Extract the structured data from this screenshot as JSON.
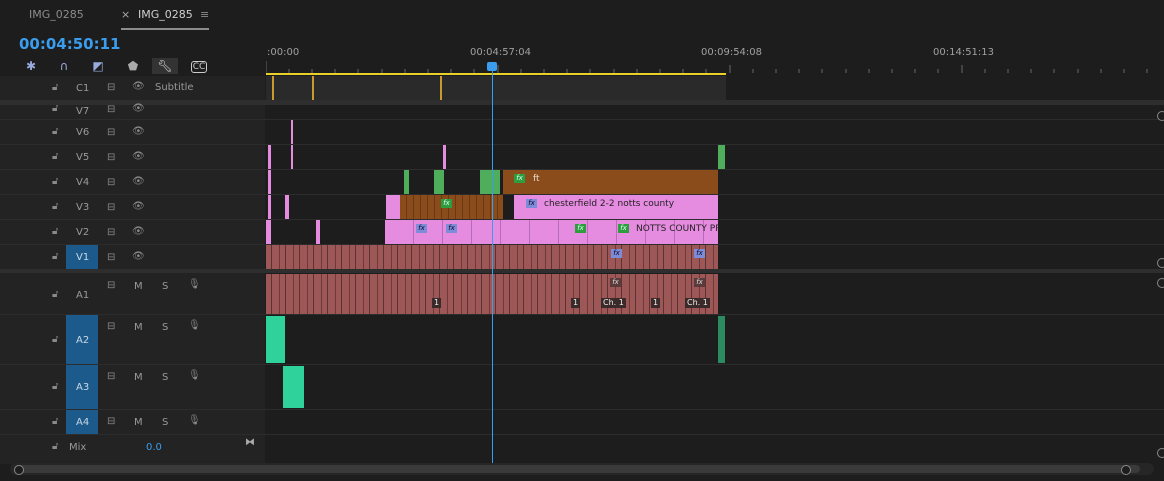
{
  "tabs": [
    {
      "label": "IMG_0285"
    },
    {
      "label": "IMG_0285",
      "close": "×",
      "menu": "≡"
    }
  ],
  "timecode": "00:04:50:11",
  "ruler": {
    "labels": [
      ":00:00",
      "00:04:57:04",
      "00:09:54:08",
      "00:14:51:13"
    ]
  },
  "tracks": {
    "caption": {
      "name": "C1",
      "label": "Subtitle"
    },
    "video": [
      "V7",
      "V6",
      "V5",
      "V4",
      "V3",
      "V2",
      "V1"
    ],
    "audio": [
      "A1",
      "A2",
      "A3",
      "A4"
    ],
    "mute": "M",
    "solo": "S",
    "mix": {
      "label": "Mix",
      "value": "0.0"
    }
  },
  "clips": {
    "v4_label": "ft",
    "v3_label": "chesterfield 2-2 notts county",
    "v2_label": "NOTTS COUNTY PR",
    "fx": "fx",
    "marker_one": "1",
    "chapter": "Ch. 1"
  },
  "colors": {
    "accent": "#3a9ded",
    "video_clip_pink": "#e58be0",
    "video_clip_brown": "#8b4c1c",
    "av_clip": "#9c5756",
    "audio_green": "#2fd29b",
    "target_blue": "#1c5a8c"
  }
}
